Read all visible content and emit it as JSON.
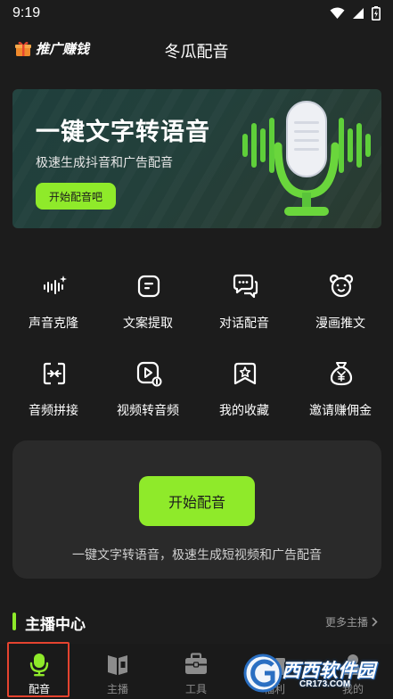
{
  "status_bar": {
    "time": "9:19",
    "icons": [
      "wifi-icon",
      "signal-icon",
      "battery-icon"
    ]
  },
  "header": {
    "promo_label": "推广赚钱",
    "promo_icon": "gift-icon",
    "title": "冬瓜配音"
  },
  "banner": {
    "headline": "一键文字转语音",
    "subtitle": "极速生成抖音和广告配音",
    "button_label": "开始配音吧",
    "image": "microphone-illustration"
  },
  "tools": [
    {
      "label": "声音克隆",
      "icon": "voice-clone-icon"
    },
    {
      "label": "文案提取",
      "icon": "text-extract-icon"
    },
    {
      "label": "对话配音",
      "icon": "dialogue-icon"
    },
    {
      "label": "漫画推文",
      "icon": "comic-bear-icon"
    },
    {
      "label": "音频拼接",
      "icon": "audio-merge-icon"
    },
    {
      "label": "视频转音频",
      "icon": "video-to-audio-icon"
    },
    {
      "label": "我的收藏",
      "icon": "star-icon"
    },
    {
      "label": "邀请赚佣金",
      "icon": "money-bag-icon"
    }
  ],
  "start_card": {
    "button_label": "开始配音",
    "description": "一键文字转语音，极速生成短视频和广告配音"
  },
  "anchors_section": {
    "title": "主播中心",
    "more_label": "更多主播"
  },
  "bottom_nav": [
    {
      "label": "配音",
      "icon": "mic-icon",
      "active": true
    },
    {
      "label": "主播",
      "icon": "anchor-book-icon",
      "active": false
    },
    {
      "label": "工具",
      "icon": "toolbox-icon",
      "active": false
    },
    {
      "label": "福利",
      "icon": "gift-icon",
      "active": false
    },
    {
      "label": "我的",
      "icon": "user-icon",
      "active": false
    }
  ],
  "watermark": {
    "text": "西西软件园",
    "url": "CR173.COM"
  },
  "colors": {
    "background": "#1c1c1c",
    "accent": "#8fea2a",
    "card": "#2a2a2a",
    "active_outline": "#e5432f"
  }
}
